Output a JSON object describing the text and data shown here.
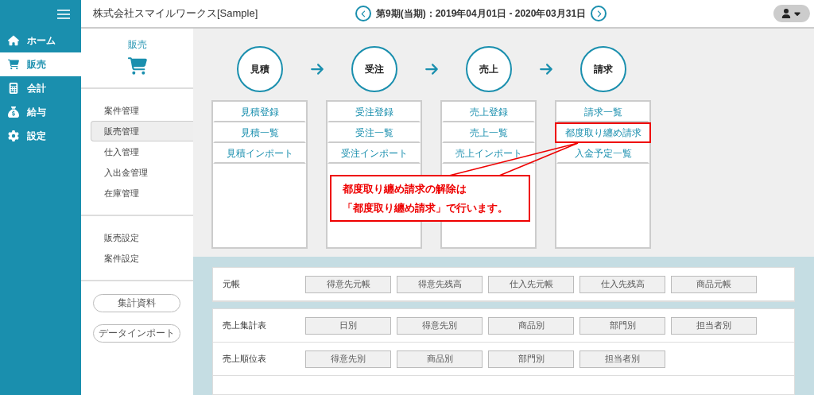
{
  "nav": {
    "items": [
      {
        "label": "ホーム",
        "selected": false
      },
      {
        "label": "販売",
        "selected": true
      },
      {
        "label": "会計",
        "selected": false
      },
      {
        "label": "給与",
        "selected": false
      },
      {
        "label": "設定",
        "selected": false
      }
    ]
  },
  "header": {
    "company": "株式会社スマイルワークス[Sample]",
    "period": "第9期(当期)：2019年04月01日 - 2020年03月31日"
  },
  "subnav": {
    "title": "販売",
    "groups": [
      [
        {
          "label": "案件管理",
          "selected": false
        },
        {
          "label": "販売管理",
          "selected": true
        },
        {
          "label": "仕入管理",
          "selected": false
        },
        {
          "label": "入出金管理",
          "selected": false
        },
        {
          "label": "在庫管理",
          "selected": false
        }
      ],
      [
        {
          "label": "販売設定",
          "selected": false
        },
        {
          "label": "案件設定",
          "selected": false
        }
      ]
    ],
    "buttons": [
      "集計資料",
      "データインポート"
    ]
  },
  "flow": {
    "stages": [
      {
        "title": "見積",
        "items": [
          {
            "label": "見積登録",
            "highlighted": false
          },
          {
            "label": "見積一覧",
            "highlighted": false
          },
          {
            "label": "見積インポート",
            "highlighted": false
          }
        ]
      },
      {
        "title": "受注",
        "items": [
          {
            "label": "受注登録",
            "highlighted": false
          },
          {
            "label": "受注一覧",
            "highlighted": false
          },
          {
            "label": "受注インポート",
            "highlighted": false
          }
        ]
      },
      {
        "title": "売上",
        "items": [
          {
            "label": "売上登録",
            "highlighted": false
          },
          {
            "label": "売上一覧",
            "highlighted": false
          },
          {
            "label": "売上インポート",
            "highlighted": false
          }
        ]
      },
      {
        "title": "請求",
        "items": [
          {
            "label": "請求一覧",
            "highlighted": false
          },
          {
            "label": "都度取り纏め請求",
            "highlighted": true
          },
          {
            "label": "入金予定一覧",
            "highlighted": false
          }
        ]
      }
    ]
  },
  "callout": {
    "lines": [
      "都度取り纏め請求の解除は",
      "「都度取り纏め請求」で行います。"
    ]
  },
  "reports": {
    "cards": [
      {
        "rows": [
          {
            "label": "元帳",
            "buttons": [
              "得意先元帳",
              "得意先残高",
              "仕入先元帳",
              "仕入先残高",
              "商品元帳"
            ]
          }
        ]
      },
      {
        "rows": [
          {
            "label": "売上集計表",
            "buttons": [
              "日別",
              "得意先別",
              "商品別",
              "部門別",
              "担当者別"
            ]
          },
          {
            "label": "売上順位表",
            "buttons": [
              "得意先別",
              "商品別",
              "部門別",
              "担当者別"
            ]
          }
        ]
      }
    ]
  }
}
